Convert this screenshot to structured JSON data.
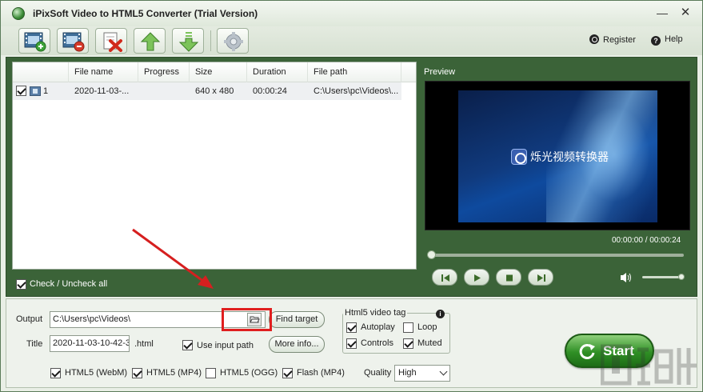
{
  "window": {
    "title": "iPixSoft Video to HTML5 Converter (Trial Version)",
    "minimize_glyph": "—",
    "close_glyph": "✕"
  },
  "toolbar": {
    "buttons": [
      {
        "name": "add-video-button",
        "icon": "film-add-icon"
      },
      {
        "name": "remove-video-button",
        "icon": "film-remove-icon"
      },
      {
        "name": "clear-list-button",
        "icon": "delete-x-icon"
      },
      {
        "name": "move-up-button",
        "icon": "arrow-up-icon"
      },
      {
        "name": "move-down-button",
        "icon": "arrow-down-icon"
      },
      {
        "name": "settings-button",
        "icon": "gear-icon"
      }
    ],
    "register_label": "Register",
    "help_label": "Help"
  },
  "file_list": {
    "columns": [
      "File name",
      "Progress",
      "Size",
      "Duration",
      "File path"
    ],
    "rows": [
      {
        "index": "1",
        "checked": true,
        "file_name": "2020-11-03-...",
        "progress": "",
        "size": "640 x 480",
        "duration": "00:00:24",
        "file_path": "C:\\Users\\pc\\Videos\\..."
      }
    ],
    "check_all_label": "Check / Uncheck all"
  },
  "preview": {
    "label": "Preview",
    "video_caption": "烁光视频转换器",
    "time_display": "00:00:00 / 00:00:24",
    "position_fraction": 0.0,
    "volume_fraction": 1.0
  },
  "settings": {
    "output_label": "Output",
    "output_value": "C:\\Users\\pc\\Videos\\",
    "find_target_label": "Find target",
    "title_label": "Title",
    "title_value": "2020-11-03-10-42-3",
    "title_ext": ".html",
    "use_input_path_label": "Use input path",
    "more_info_label": "More info...",
    "tag_group_title": "Html5 video tag",
    "tag_options": {
      "autoplay": "Autoplay",
      "loop": "Loop",
      "controls": "Controls",
      "muted": "Muted"
    },
    "formats": {
      "webm": "HTML5 (WebM)",
      "mp4": "HTML5 (MP4)",
      "ogg": "HTML5 (OGG)",
      "flash": "Flash (MP4)"
    },
    "quality_label": "Quality",
    "quality_value": "High"
  },
  "start_button_label": "Start",
  "colors": {
    "panel_green": "#3b6338",
    "start_green": "#2f8f25",
    "highlight_red": "#e01f1f"
  }
}
